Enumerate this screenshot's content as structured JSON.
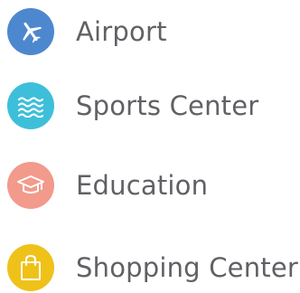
{
  "items": [
    {
      "label": "Airport",
      "icon": "airplane-icon",
      "color": "#4d88cf"
    },
    {
      "label": "Sports Center",
      "icon": "waves-icon",
      "color": "#3ebfd9"
    },
    {
      "label": "Education",
      "icon": "graduation-cap-icon",
      "color": "#f29a8c"
    },
    {
      "label": "Shopping Center",
      "icon": "shopping-bag-icon",
      "color": "#efc21a"
    }
  ]
}
